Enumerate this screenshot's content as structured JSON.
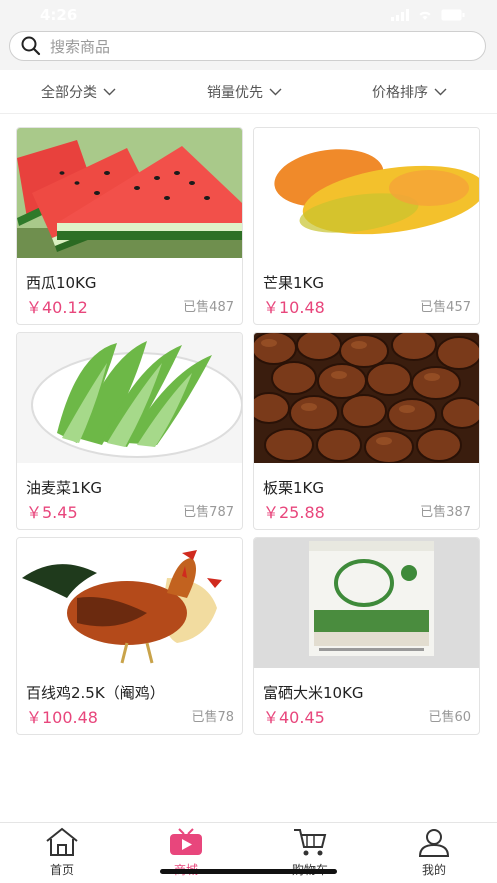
{
  "status": {
    "time": "4:26"
  },
  "search": {
    "placeholder": "搜索商品",
    "icon": "search-icon"
  },
  "filters": [
    {
      "label": "全部分类"
    },
    {
      "label": "销量优先"
    },
    {
      "label": "价格排序"
    }
  ],
  "products": [
    {
      "name": "西瓜10KG",
      "price": "￥40.12",
      "sold": "已售487",
      "image": "watermelon"
    },
    {
      "name": "芒果1KG",
      "price": "￥10.48",
      "sold": "已售457",
      "image": "mango"
    },
    {
      "name": "油麦菜1KG",
      "price": "￥5.45",
      "sold": "已售787",
      "image": "lettuce"
    },
    {
      "name": "板栗1KG",
      "price": "￥25.88",
      "sold": "已售387",
      "image": "chestnut"
    },
    {
      "name": "百线鸡2.5K（阉鸡）",
      "price": "￥100.48",
      "sold": "已售78",
      "image": "chicken"
    },
    {
      "name": "富硒大米10KG",
      "price": "￥40.45",
      "sold": "已售60",
      "image": "rice-bag"
    }
  ],
  "tabbar": [
    {
      "label": "首页",
      "icon": "home-icon"
    },
    {
      "label": "商城",
      "icon": "mall-play-icon",
      "active": true
    },
    {
      "label": "购物车",
      "icon": "cart-icon"
    },
    {
      "label": "我的",
      "icon": "user-icon"
    }
  ],
  "colors": {
    "accent": "#e8467c",
    "header_bg": "#f4f4f4"
  }
}
